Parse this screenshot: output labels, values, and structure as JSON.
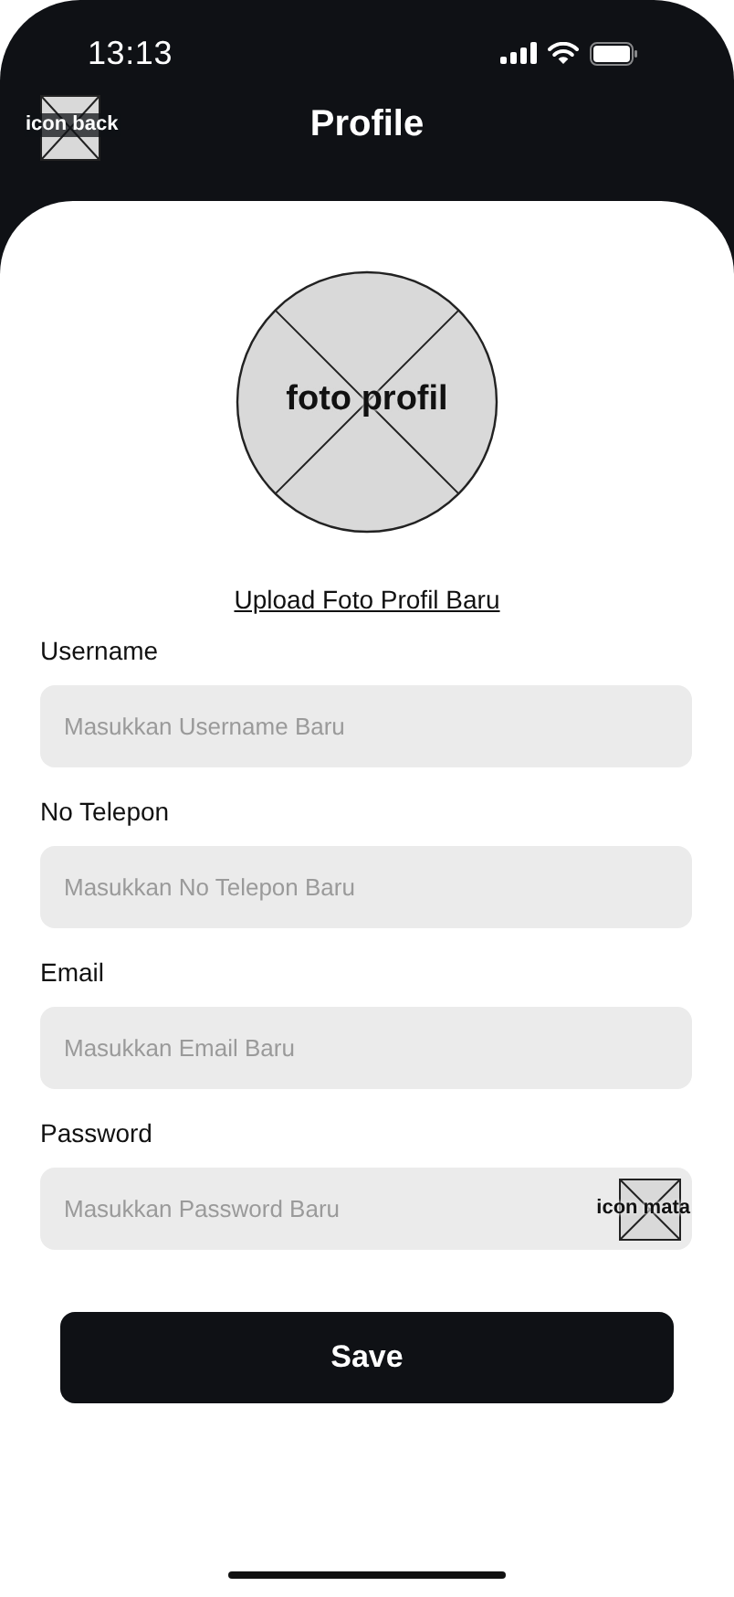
{
  "status_bar": {
    "time": "13:13"
  },
  "header": {
    "back_icon_label": "icon back",
    "title": "Profile"
  },
  "avatar": {
    "label": "foto profil"
  },
  "upload_link": "Upload Foto Profil Baru",
  "fields": [
    {
      "kind": "text",
      "label": "Username",
      "placeholder": "Masukkan Username Baru"
    },
    {
      "kind": "text",
      "label": "No Telepon",
      "placeholder": "Masukkan No Telepon Baru"
    },
    {
      "kind": "text",
      "label": "Email",
      "placeholder": "Masukkan Email Baru"
    },
    {
      "kind": "password",
      "label": "Password",
      "placeholder": "Masukkan Password Baru",
      "icon_label": "icon mata"
    }
  ],
  "save_button": "Save"
}
